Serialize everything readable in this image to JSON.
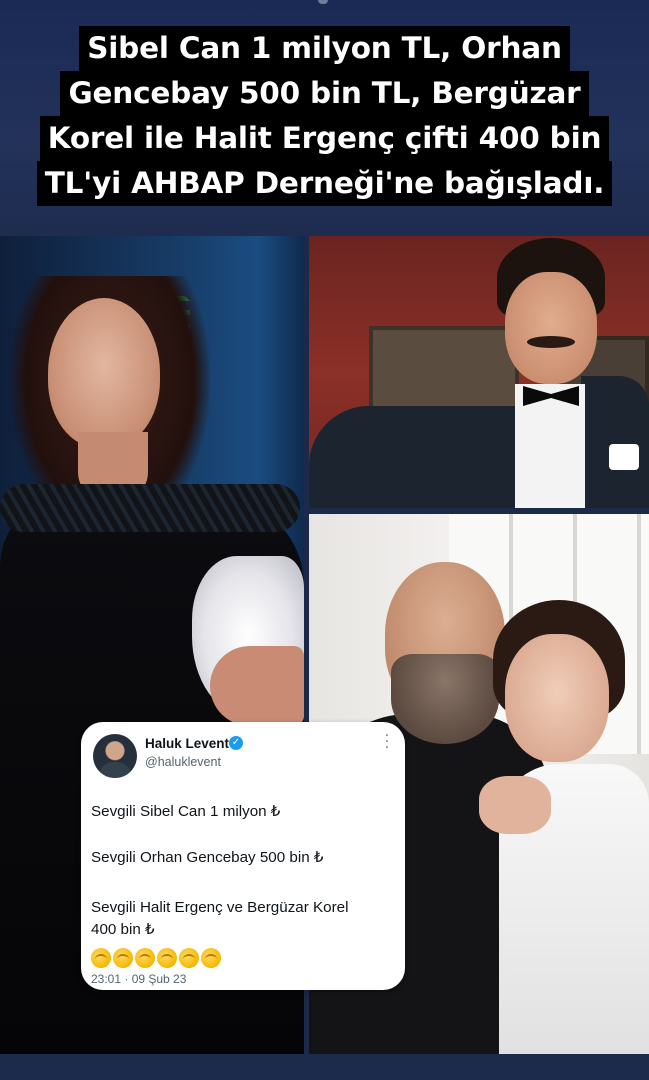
{
  "headline": {
    "lines": [
      "Sibel Can 1 milyon TL, Orhan",
      "Gencebay 500 bin TL, Bergüzar",
      "Korel ile Halit Ergenç çifti 400 bin",
      "TL'yi AHBAP Derneği'ne bağışladı."
    ]
  },
  "photos": {
    "left": "singer-portrait",
    "top_right": "man-in-tuxedo-portrait",
    "bottom_right": "couple-portrait"
  },
  "tweet": {
    "author_name": "Haluk Levent",
    "verified_icon": "verified-badge-icon",
    "handle": "@haluklevent",
    "more_icon": "more-options-icon",
    "lines": [
      "Sevgili Sibel Can 1 milyon ₺",
      "Sevgili Orhan Gencebay 500 bin ₺",
      "Sevgili Halit Ergenç ve Bergüzar Korel",
      "400 bin ₺"
    ],
    "emoji_icon": "clapping-hands-icon",
    "emoji_count": 6,
    "timestamp": "23:01 · 09 Şub 23"
  },
  "colors": {
    "headline_bg": "#000000",
    "headline_text": "#ffffff",
    "page_bg": "#1b2a4a",
    "tweet_bg": "#ffffff",
    "verified": "#1d9bf0",
    "muted_text": "#536471"
  }
}
